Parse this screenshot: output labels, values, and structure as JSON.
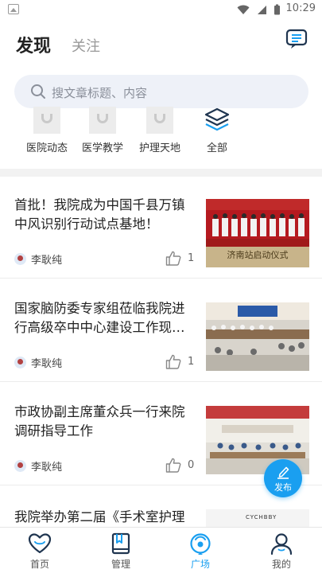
{
  "status_bar": {
    "time": "10:29"
  },
  "header": {
    "tab_discover": "发现",
    "tab_follow": "关注",
    "message_icon": "message-icon"
  },
  "search": {
    "placeholder": "搜文章标题、内容"
  },
  "categories": [
    {
      "label": "医院动态",
      "icon": "image-placeholder-icon"
    },
    {
      "label": "医学教学",
      "icon": "image-placeholder-icon"
    },
    {
      "label": "护理天地",
      "icon": "image-placeholder-icon"
    },
    {
      "label": "全部",
      "icon": "layers-icon"
    }
  ],
  "articles": [
    {
      "title": "首批！我院成为中国千县万镇中风识别行动试点基地！",
      "author": "李耿纯",
      "likes": "1",
      "thumb_caption": "济南站启动仪式"
    },
    {
      "title": "国家脑防委专家组莅临我院进行高级卒中中心建设工作现…",
      "author": "李耿纯",
      "likes": "1"
    },
    {
      "title": "市政协副主席董众兵一行来院调研指导工作",
      "author": "李耿纯",
      "likes": "0"
    }
  ],
  "partial_article": {
    "title": "我院举办第二届《手术室护理",
    "thumb_text": "CYCHBBY"
  },
  "fab": {
    "label": "发布"
  },
  "nav": [
    {
      "label": "首页",
      "icon": "home-heart-icon"
    },
    {
      "label": "管理",
      "icon": "book-icon"
    },
    {
      "label": "广场",
      "icon": "plaza-icon",
      "active": true
    },
    {
      "label": "我的",
      "icon": "user-icon"
    }
  ],
  "colors": {
    "accent": "#1a9ff0",
    "search_bg": "#eef1f8",
    "text_muted": "#999999"
  }
}
